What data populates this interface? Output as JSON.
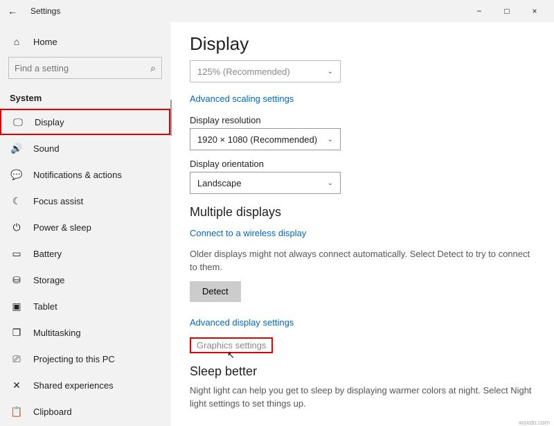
{
  "window": {
    "title": "Settings",
    "footer_label": "wsxdn.com"
  },
  "sidebar": {
    "home_label": "Home",
    "search_placeholder": "Find a setting",
    "section_label": "System",
    "items": [
      {
        "label": "Display",
        "icon": "🖵",
        "active": true
      },
      {
        "label": "Sound",
        "icon": "🔊"
      },
      {
        "label": "Notifications & actions",
        "icon": "💬"
      },
      {
        "label": "Focus assist",
        "icon": "☾"
      },
      {
        "label": "Power & sleep",
        "icon": "⏻"
      },
      {
        "label": "Battery",
        "icon": "▭"
      },
      {
        "label": "Storage",
        "icon": "⛁"
      },
      {
        "label": "Tablet",
        "icon": "▣"
      },
      {
        "label": "Multitasking",
        "icon": "❐"
      },
      {
        "label": "Projecting to this PC",
        "icon": "⎚"
      },
      {
        "label": "Shared experiences",
        "icon": "✕"
      },
      {
        "label": "Clipboard",
        "icon": "📋"
      }
    ]
  },
  "content": {
    "title": "Display",
    "scale_value_truncated": "125% (Recommended)",
    "advanced_scaling_link": "Advanced scaling settings",
    "resolution_label": "Display resolution",
    "resolution_value": "1920 × 1080 (Recommended)",
    "orientation_label": "Display orientation",
    "orientation_value": "Landscape",
    "multiple_displays_heading": "Multiple displays",
    "connect_wireless_link": "Connect to a wireless display",
    "older_displays_text": "Older displays might not always connect automatically. Select Detect to try to connect to them.",
    "detect_button": "Detect",
    "advanced_display_link": "Advanced display settings",
    "graphics_link": "Graphics settings",
    "sleep_heading": "Sleep better",
    "sleep_text": "Night light can help you get to sleep by displaying warmer colors at night. Select Night light settings to set things up."
  }
}
